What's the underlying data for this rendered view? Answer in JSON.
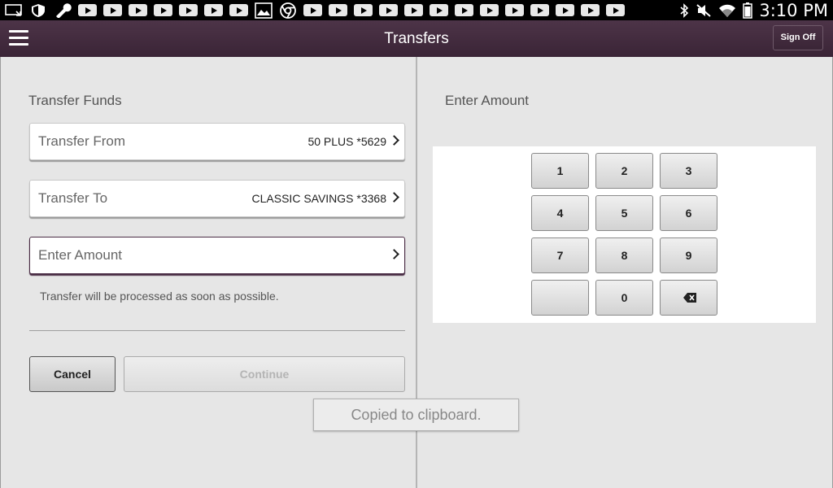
{
  "status_bar": {
    "time": "3:10 PM",
    "left_icons": [
      "screen-cast-icon",
      "shield-icon",
      "wrench-icon",
      "youtube-icon",
      "youtube-icon",
      "youtube-icon",
      "youtube-icon",
      "youtube-icon",
      "youtube-icon",
      "youtube-icon",
      "gallery-icon",
      "chrome-icon",
      "youtube-icon",
      "youtube-icon",
      "youtube-icon",
      "youtube-icon",
      "youtube-icon",
      "youtube-icon",
      "youtube-icon",
      "youtube-icon",
      "youtube-icon",
      "youtube-icon",
      "youtube-icon",
      "youtube-icon",
      "youtube-icon"
    ],
    "right_icons": [
      "bluetooth-icon",
      "mute-icon",
      "wifi-icon",
      "battery-icon"
    ]
  },
  "app_bar": {
    "title": "Transfers",
    "sign_off_label": "Sign Off"
  },
  "left_panel": {
    "section_title": "Transfer Funds",
    "fields": [
      {
        "label": "Transfer From",
        "value": "50 PLUS *5629"
      },
      {
        "label": "Transfer To",
        "value": "CLASSIC SAVINGS *3368"
      },
      {
        "label": "Enter Amount",
        "value": ""
      }
    ],
    "note": "Transfer will be processed as soon as possible.",
    "cancel_label": "Cancel",
    "continue_label": "Continue"
  },
  "right_panel": {
    "section_title": "Enter Amount",
    "keys": [
      "1",
      "2",
      "3",
      "4",
      "5",
      "6",
      "7",
      "8",
      "9",
      "",
      "0",
      "backspace"
    ]
  },
  "toast": {
    "message": "Copied to clipboard."
  },
  "colors": {
    "app_bar": "#3f2a3c",
    "active_field_border": "#4a2d45",
    "background": "#e6e6e6"
  }
}
